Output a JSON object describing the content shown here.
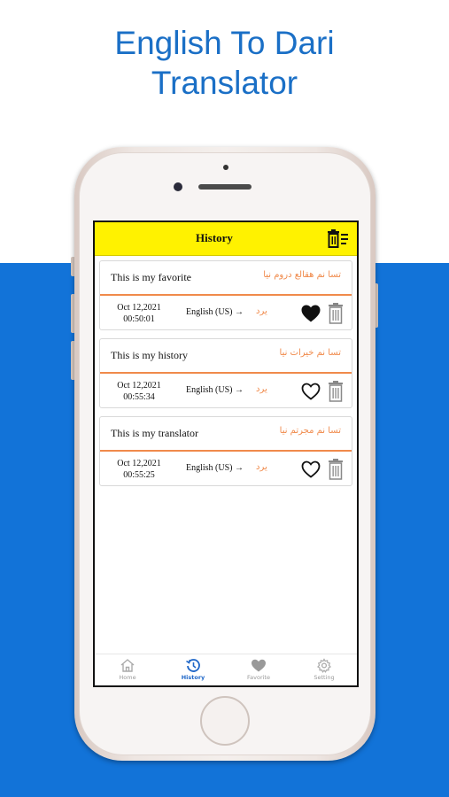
{
  "headline": {
    "line1": "English To Dari",
    "line2": "Translator"
  },
  "screen": {
    "title": "History",
    "entries": [
      {
        "source": "This is my favorite",
        "translation": "تسا نم هقالع دروم نیا",
        "date": "Oct 12,2021",
        "time": "00:50:01",
        "from_lang": "English (US) →",
        "to_lang": "یرد",
        "favorited": true
      },
      {
        "source": "This is my history",
        "translation": "تسا نم خیرات نیا",
        "date": "Oct 12,2021",
        "time": "00:55:34",
        "from_lang": "English (US) →",
        "to_lang": "یرد",
        "favorited": false
      },
      {
        "source": "This is my translator",
        "translation": "تسا نم مجرتم نیا",
        "date": "Oct 12,2021",
        "time": "00:55:25",
        "from_lang": "English (US) →",
        "to_lang": "یرد",
        "favorited": false
      }
    ],
    "tabs": [
      {
        "label": "Home",
        "icon": "home-icon"
      },
      {
        "label": "History",
        "icon": "history-icon"
      },
      {
        "label": "Favorite",
        "icon": "heart-icon"
      },
      {
        "label": "Setting",
        "icon": "gear-icon"
      }
    ],
    "active_tab": "History"
  },
  "colors": {
    "topbar": "#fff200",
    "accent": "#f08a4b",
    "background_blue": "#1273d8",
    "headline": "#1a6fc6",
    "active_tab": "#1e66c8"
  }
}
